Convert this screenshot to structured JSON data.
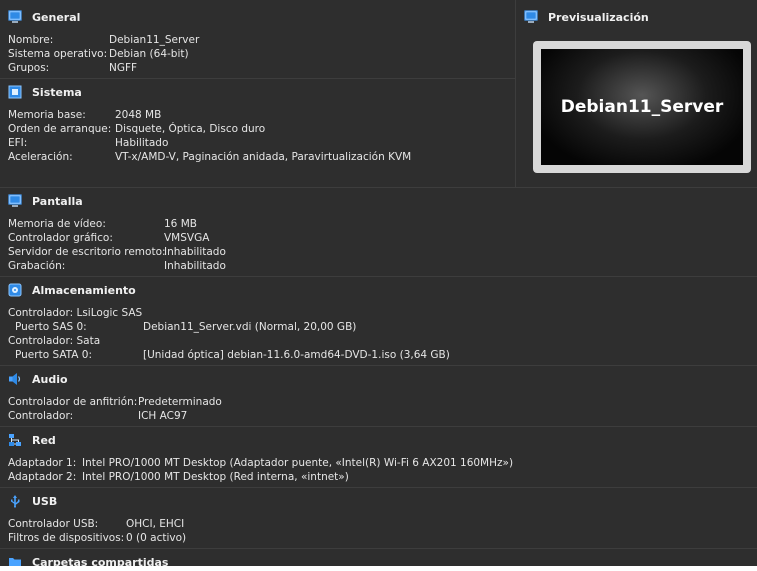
{
  "general": {
    "title": "General",
    "rows": [
      {
        "key": "Nombre:",
        "value": "Debian11_Server"
      },
      {
        "key": "Sistema operativo:",
        "value": "Debian (64-bit)"
      },
      {
        "key": "Grupos:",
        "value": "NGFF"
      }
    ]
  },
  "preview": {
    "title": "Previsualización",
    "vm_name": "Debian11_Server"
  },
  "sistema": {
    "title": "Sistema",
    "rows": [
      {
        "key": "Memoria base:",
        "value": "2048 MB"
      },
      {
        "key": "Orden de arranque:",
        "value": "Disquete, Óptica, Disco duro"
      },
      {
        "key": "EFI:",
        "value": "Habilitado"
      },
      {
        "key": "Aceleración:",
        "value": "VT-x/AMD-V, Paginación anidada, Paravirtualización KVM"
      }
    ]
  },
  "pantalla": {
    "title": "Pantalla",
    "rows": [
      {
        "key": "Memoria de vídeo:",
        "value": "16 MB"
      },
      {
        "key": "Controlador gráfico:",
        "value": "VMSVGA"
      },
      {
        "key": "Servidor de escritorio remoto:",
        "value": "Inhabilitado"
      },
      {
        "key": "Grabación:",
        "value": "Inhabilitado"
      }
    ]
  },
  "almacenamiento": {
    "title": "Almacenamiento",
    "rows": [
      {
        "key": "Controlador: LsiLogic SAS",
        "value": ""
      },
      {
        "key": " Puerto SAS 0:",
        "value": "Debian11_Server.vdi (Normal, 20,00 GB)"
      },
      {
        "key": "Controlador: Sata",
        "value": ""
      },
      {
        "key": " Puerto SATA 0:",
        "value": "[Unidad óptica] debian-11.6.0-amd64-DVD-1.iso (3,64 GB)"
      }
    ]
  },
  "audio": {
    "title": "Audio",
    "rows": [
      {
        "key": "Controlador de anfitrión:",
        "value": "Predeterminado"
      },
      {
        "key": "Controlador:",
        "value": "ICH AC97"
      }
    ]
  },
  "red": {
    "title": "Red",
    "rows": [
      {
        "key": "Adaptador 1:",
        "value": "Intel PRO/1000 MT Desktop (Adaptador puente, «Intel(R) Wi-Fi 6 AX201 160MHz»)"
      },
      {
        "key": "Adaptador 2:",
        "value": "Intel PRO/1000 MT Desktop (Red interna, «intnet»)"
      }
    ]
  },
  "usb": {
    "title": "USB",
    "rows": [
      {
        "key": "Controlador USB:",
        "value": "OHCI, EHCI"
      },
      {
        "key": "Filtros de dispositivos:",
        "value": "0 (0 activo)"
      }
    ]
  },
  "carpetas": {
    "title": "Carpetas compartidas"
  },
  "icons": {
    "general": "monitor-icon",
    "preview": "monitor-icon",
    "sistema": "chip-icon",
    "pantalla": "display-icon",
    "almacenamiento": "storage-icon",
    "audio": "speaker-icon",
    "red": "network-icon",
    "usb": "usb-icon",
    "carpetas": "folder-icon"
  }
}
